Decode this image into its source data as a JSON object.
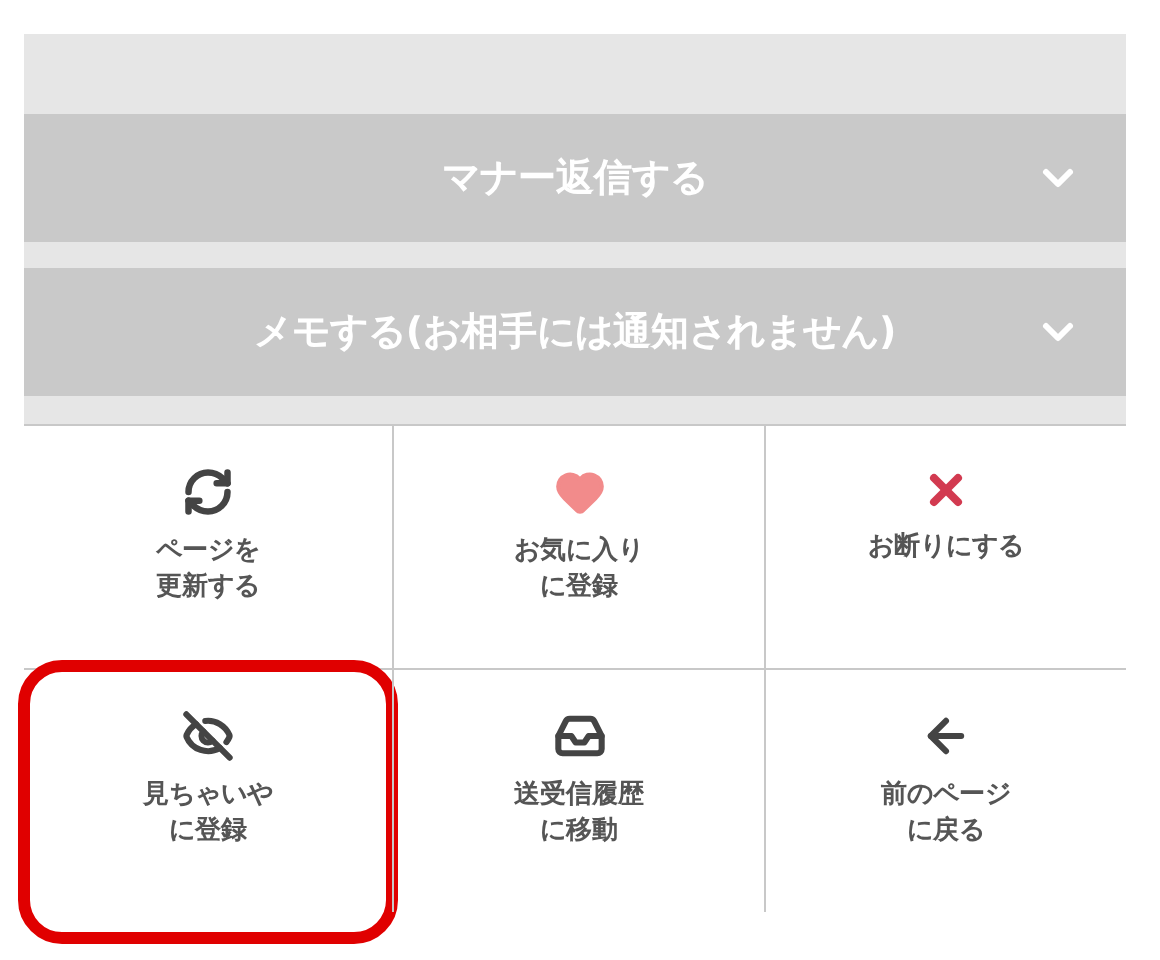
{
  "accordions": [
    {
      "label": "マナー返信する",
      "expanded": false
    },
    {
      "label": "メモする(お相手には通知されません)",
      "expanded": false
    }
  ],
  "actions": [
    {
      "lines": [
        "ページを",
        "更新する"
      ],
      "highlighted": false
    },
    {
      "lines": [
        "お気に入り",
        "に登録"
      ],
      "highlighted": false
    },
    {
      "lines": [
        "お断りにする"
      ],
      "highlighted": false
    },
    {
      "lines": [
        "見ちゃいや",
        "に登録"
      ],
      "highlighted": true
    },
    {
      "lines": [
        "送受信履歴",
        "に移動"
      ],
      "highlighted": false
    },
    {
      "lines": [
        "前のページ",
        "に戻る"
      ],
      "highlighted": false
    }
  ]
}
